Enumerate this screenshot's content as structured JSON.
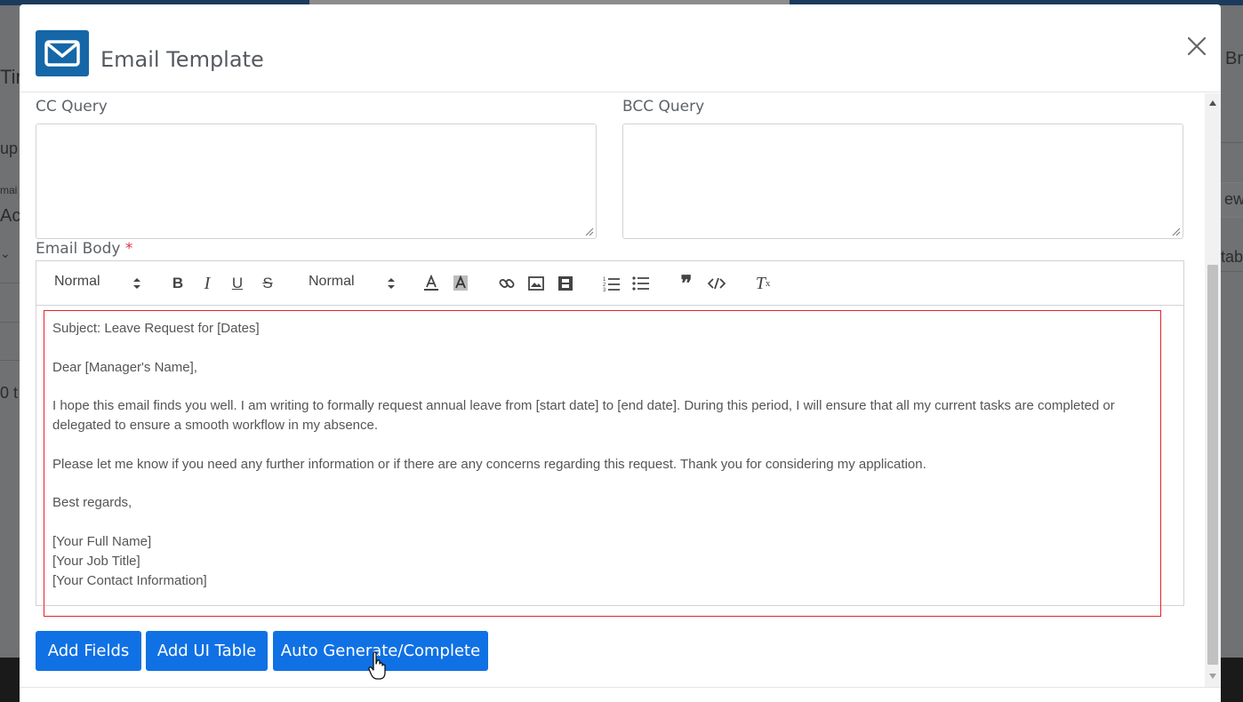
{
  "background": {
    "left_fragments": [
      "Tin",
      "up",
      "mai",
      "Act",
      "0 t"
    ],
    "right_fragments": [
      "Bro",
      "ew",
      "tabl"
    ]
  },
  "modal": {
    "title": "Email Template",
    "header_icon": "envelope-icon",
    "close_icon": "close-icon",
    "accent_color": "#1071e5",
    "header_icon_color": "#1567a8"
  },
  "cc_query": {
    "label": "CC Query",
    "value": ""
  },
  "bcc_query": {
    "label": "BCC Query",
    "value": ""
  },
  "email_body": {
    "label": "Email Body",
    "required_marker": "*",
    "toolbar": {
      "header_select": "Normal",
      "size_select": "Normal",
      "buttons": [
        "bold-icon",
        "italic-icon",
        "underline-icon",
        "strike-icon",
        "font-color-icon",
        "background-color-icon",
        "link-icon",
        "image-icon",
        "video-icon",
        "ordered-list-icon",
        "bullet-list-icon",
        "blockquote-icon",
        "code-block-icon",
        "clear-format-icon"
      ]
    },
    "content": {
      "subject": "Subject: Leave Request for [Dates]",
      "greeting": "Dear [Manager's Name],",
      "paragraph1": "I hope this email finds you well. I am writing to formally request annual leave from [start date] to [end date]. During this period, I will ensure that all my current tasks are completed or delegated to ensure a smooth workflow in my absence.",
      "paragraph2": "Please let me know if you need any further information or if there are any concerns regarding this request. Thank you for considering my application.",
      "closing": "Best regards,",
      "name": "[Your Full Name]",
      "job_title": "[Your Job Title]",
      "contact": "[Your Contact Information]"
    },
    "highlight_color": "#e0252c"
  },
  "buttons": {
    "add_fields": "Add Fields",
    "add_ui_table": "Add UI Table",
    "auto_generate": "Auto Generate/Complete"
  }
}
